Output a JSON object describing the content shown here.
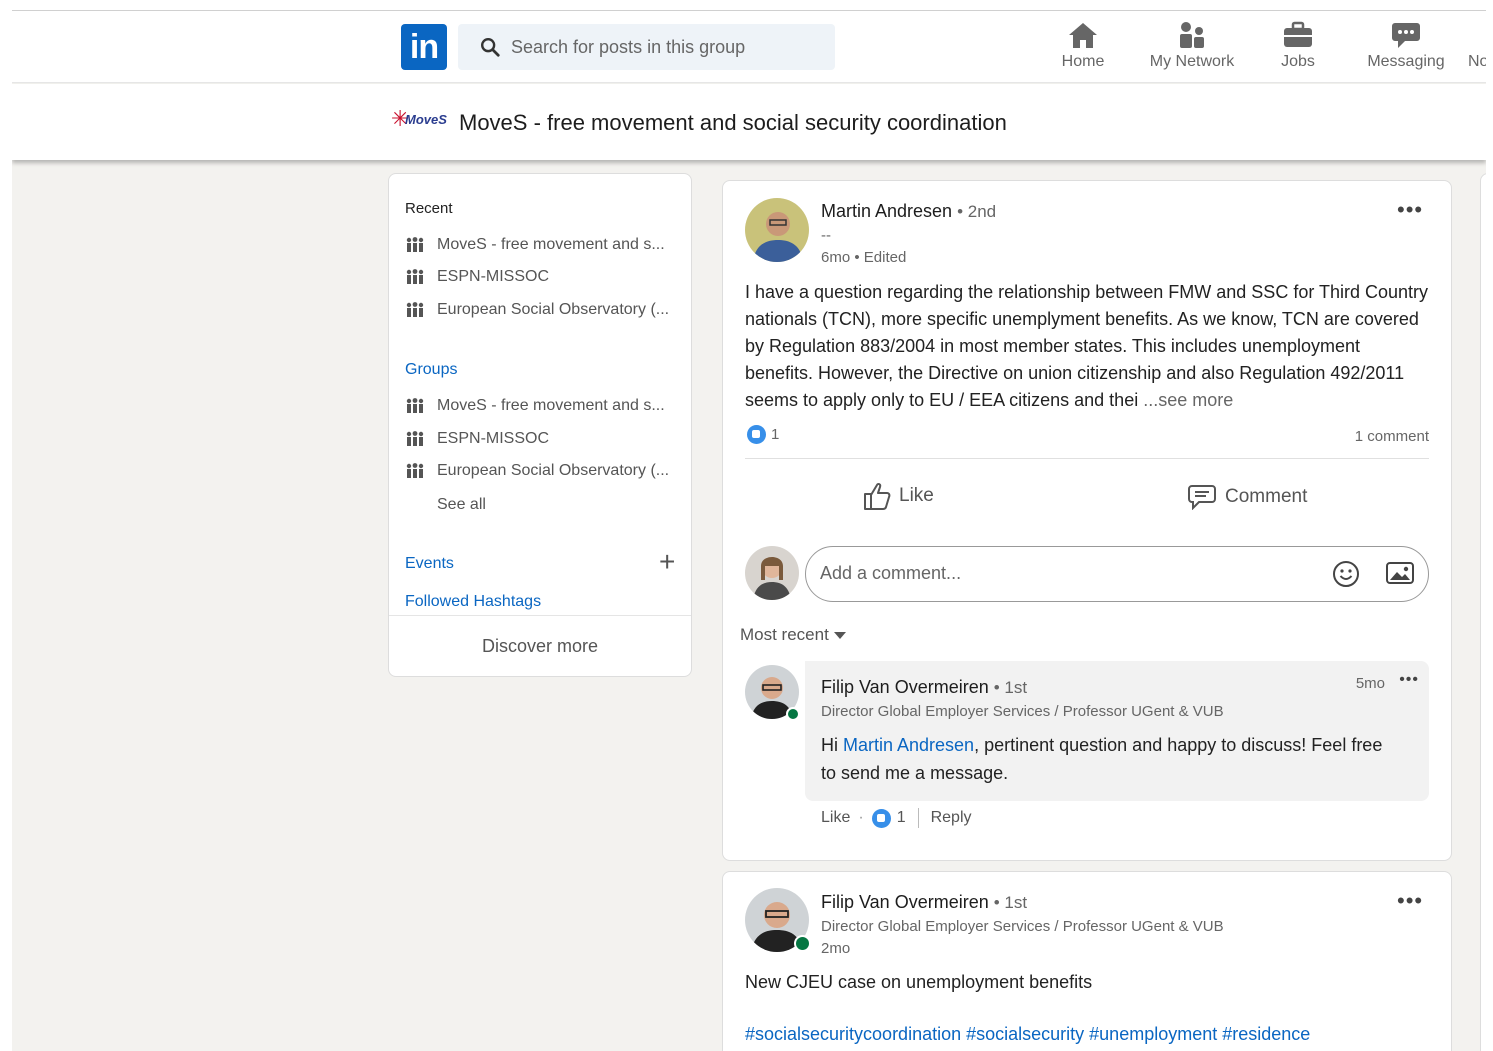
{
  "header": {
    "logo_text": "in",
    "search_placeholder": "Search for posts in this group",
    "nav": [
      {
        "label": "Home"
      },
      {
        "label": "My Network"
      },
      {
        "label": "Jobs"
      },
      {
        "label": "Messaging"
      },
      {
        "label": "No"
      }
    ]
  },
  "group": {
    "logo_text": "MoveS",
    "title": "MoveS - free movement and social security coordination"
  },
  "sidebar": {
    "recent_heading": "Recent",
    "recent": [
      "MoveS - free movement and s...",
      "ESPN-MISSOC",
      "European Social Observatory (..."
    ],
    "groups_heading": "Groups",
    "groups": [
      "MoveS - free movement and s...",
      "ESPN-MISSOC",
      "European Social Observatory (..."
    ],
    "see_all": "See all",
    "events": "Events",
    "plus": "+",
    "followed_hashtags": "Followed Hashtags",
    "discover_more": "Discover more"
  },
  "post1": {
    "author": "Martin Andresen",
    "degree": "• 2nd",
    "headline": "--",
    "meta": "6mo • Edited",
    "dots": "•••",
    "text": "I have a question regarding the relationship between FMW and SSC for Third Country nationals (TCN), more specific unemplyment benefits. As we know, TCN are covered by Regulation 883/2004 in most member states. This includes unemployment benefits. However, the Directive on union citizenship and also Regulation 492/2011 seems to apply only to EU / EEA citizens and thei",
    "see_more": "...see more",
    "reactions": "1",
    "comments_count": "1 comment",
    "like_label": "Like",
    "comment_label": "Comment",
    "comment_placeholder": "Add a comment...",
    "sort": "Most recent",
    "comment": {
      "author": "Filip Van Overmeiren",
      "degree": "• 1st",
      "headline": "Director Global Employer Services / Professor UGent & VUB",
      "time": "5mo",
      "dots": "•••",
      "greeting": "Hi ",
      "mention": "Martin Andresen",
      "text": ", pertinent question and happy to discuss! Feel free to send me a message.",
      "like": "Like",
      "dot_sep": "·",
      "reactions": "1",
      "reply": "Reply"
    }
  },
  "post2": {
    "author": "Filip Van Overmeiren",
    "degree": "• 1st",
    "headline": "Director Global Employer Services / Professor UGent & VUB",
    "meta": "2mo",
    "dots": "•••",
    "text": "New CJEU case on unemployment benefits",
    "hashtags": "#socialsecuritycoordination #socialsecurity #unemployment #residence"
  },
  "colors": {
    "brand": "#0a66c2",
    "background": "#f3f2ef",
    "online": "#057642"
  }
}
